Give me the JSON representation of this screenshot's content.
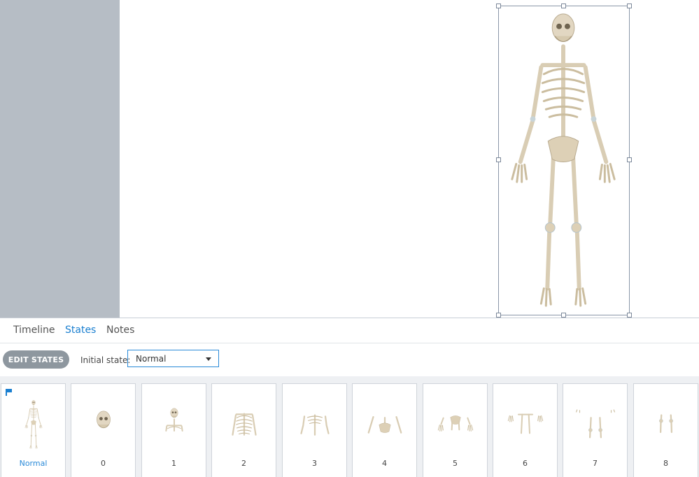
{
  "tabs": [
    {
      "label": "Timeline"
    },
    {
      "label": "States"
    },
    {
      "label": "Notes"
    }
  ],
  "active_tab": "States",
  "toolbar": {
    "edit_states_label": "EDIT STATES",
    "initial_state_label": "Initial state:",
    "initial_state_value": "Normal"
  },
  "states": [
    {
      "label": "Normal",
      "initial": true
    },
    {
      "label": "0"
    },
    {
      "label": "1"
    },
    {
      "label": "2"
    },
    {
      "label": "3"
    },
    {
      "label": "4"
    },
    {
      "label": "5"
    },
    {
      "label": "6"
    },
    {
      "label": "7"
    },
    {
      "label": "8"
    }
  ],
  "colors": {
    "accent": "#1a7fd0",
    "left_panel": "#b6bdc5",
    "button": "#8e979f"
  }
}
